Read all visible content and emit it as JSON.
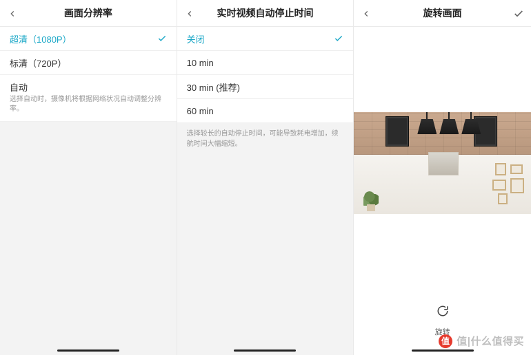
{
  "panel1": {
    "title": "画面分辨率",
    "options": [
      {
        "label": "超清（1080P）",
        "selected": true
      },
      {
        "label": "标清（720P）",
        "selected": false
      }
    ],
    "auto": {
      "label": "自动",
      "hint": "选择自动时，摄像机将根据网络状况自动调整分辨率。"
    }
  },
  "panel2": {
    "title": "实时视频自动停止时间",
    "options": [
      {
        "label": "关闭",
        "selected": true
      },
      {
        "label": "10 min",
        "selected": false
      },
      {
        "label": "30 min (推荐)",
        "selected": false
      },
      {
        "label": "60 min",
        "selected": false
      }
    ],
    "note": "选择较长的自动停止时间，可能导致耗电增加，续航时间大幅缩短。"
  },
  "panel3": {
    "title": "旋转画面",
    "rotate_label": "旋转"
  },
  "watermark": {
    "text": "值|什么值得买"
  }
}
